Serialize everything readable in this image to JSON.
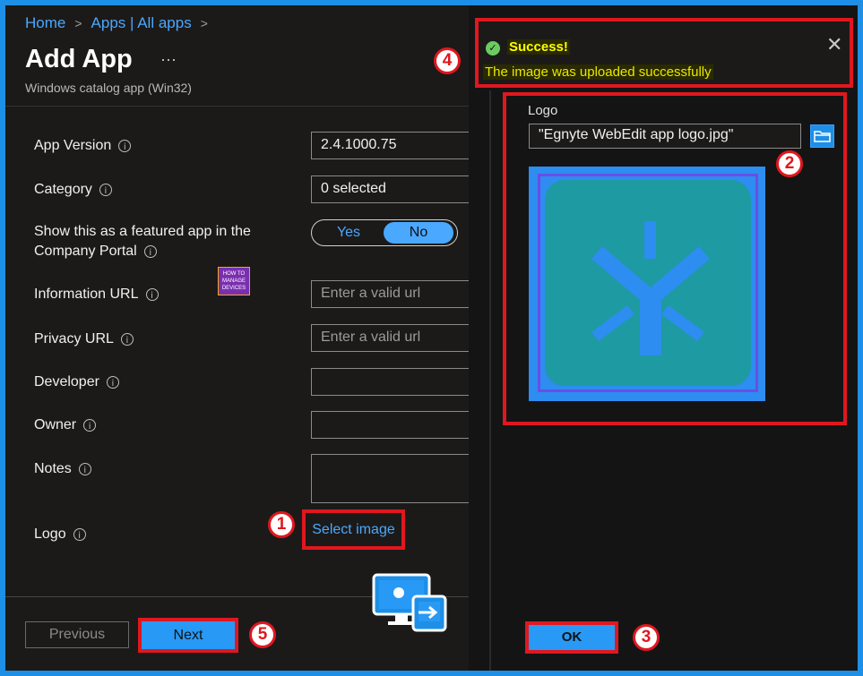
{
  "breadcrumb": {
    "items": [
      "Home",
      "Apps | All apps"
    ]
  },
  "page": {
    "title": "Add App",
    "more": "···",
    "subtitle": "Windows catalog app (Win32)"
  },
  "form": {
    "app_version": {
      "label": "App Version",
      "value": "2.4.1000.75"
    },
    "category": {
      "label": "Category",
      "value": "0 selected"
    },
    "featured": {
      "label_line1": "Show this as a featured app in the",
      "label_line2": "Company Portal",
      "yes": "Yes",
      "no": "No",
      "selected": "No"
    },
    "information_url": {
      "label": "Information URL",
      "placeholder": "Enter a valid url"
    },
    "privacy_url": {
      "label": "Privacy URL",
      "placeholder": "Enter a valid url"
    },
    "developer": {
      "label": "Developer",
      "value": ""
    },
    "owner": {
      "label": "Owner",
      "value": ""
    },
    "notes": {
      "label": "Notes",
      "value": ""
    },
    "logo": {
      "label": "Logo",
      "select_label": "Select image"
    }
  },
  "footer": {
    "previous": "Previous",
    "next": "Next"
  },
  "toast": {
    "title": "Success!",
    "message": "The image was uploaded successfully",
    "close": "✕"
  },
  "logo_panel": {
    "label": "Logo",
    "file_name": "\"Egnyte WebEdit app logo.jpg\"",
    "ok": "OK"
  },
  "watermark": {
    "line1": "HOW TO",
    "line2": "MANAGE",
    "line3": "DEVICES"
  },
  "badges": {
    "b1": "1",
    "b2": "2",
    "b3": "3",
    "b4": "4",
    "b5": "5"
  },
  "colors": {
    "accent": "#2899f5",
    "highlight": "#e0171f",
    "success": "#6ccb5f",
    "logo_bg": "#1e9aa2",
    "logo_fg": "#2d8df0"
  },
  "icons": [
    "chevron-right-icon",
    "info-icon",
    "checkmark-icon",
    "close-icon",
    "folder-browse-icon",
    "remote-desktop-icon"
  ]
}
